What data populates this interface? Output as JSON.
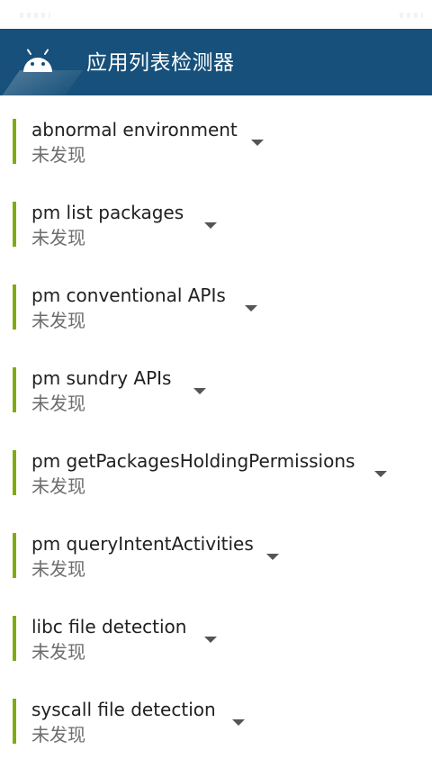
{
  "app": {
    "title": "应用列表检测器",
    "logo_icon": "android-icon",
    "header_color": "#17507a",
    "accent_color": "#7fac12"
  },
  "items": [
    {
      "title": "abnormal environment",
      "status": "未发现"
    },
    {
      "title": "pm list packages",
      "status": "未发现"
    },
    {
      "title": "pm conventional APIs",
      "status": "未发现"
    },
    {
      "title": "pm sundry APIs",
      "status": "未发现"
    },
    {
      "title": "pm getPackagesHoldingPermissions",
      "status": "未发现"
    },
    {
      "title": "pm queryIntentActivities",
      "status": "未发现"
    },
    {
      "title": "libc file detection",
      "status": "未发现"
    },
    {
      "title": "syscall file detection",
      "status": "未发现"
    }
  ]
}
